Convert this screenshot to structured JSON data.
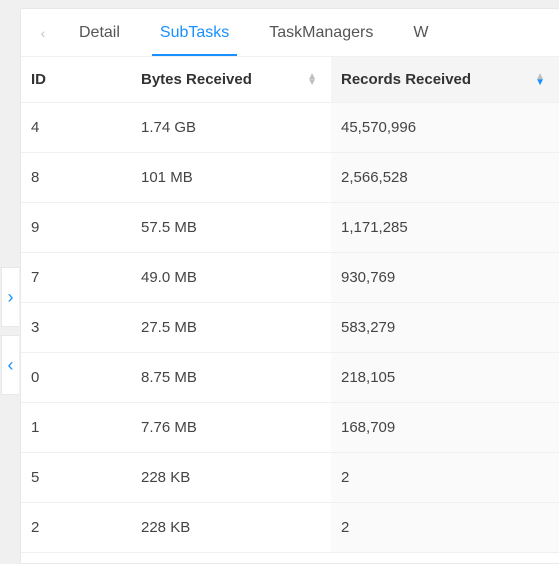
{
  "tabs": {
    "items": [
      {
        "label": "Detail"
      },
      {
        "label": "SubTasks"
      },
      {
        "label": "TaskManagers"
      },
      {
        "label": "W"
      }
    ],
    "active_index": 1
  },
  "columns": {
    "id": "ID",
    "bytes_received": "Bytes Received",
    "records_received": "Records Received"
  },
  "sort": {
    "column": "records_received",
    "direction": "desc"
  },
  "rows": [
    {
      "id": "4",
      "bytes_received": "1.74 GB",
      "records_received": "45,570,996"
    },
    {
      "id": "8",
      "bytes_received": "101 MB",
      "records_received": "2,566,528"
    },
    {
      "id": "9",
      "bytes_received": "57.5 MB",
      "records_received": "1,171,285"
    },
    {
      "id": "7",
      "bytes_received": "49.0 MB",
      "records_received": "930,769"
    },
    {
      "id": "3",
      "bytes_received": "27.5 MB",
      "records_received": "583,279"
    },
    {
      "id": "0",
      "bytes_received": "8.75 MB",
      "records_received": "218,105"
    },
    {
      "id": "1",
      "bytes_received": "7.76 MB",
      "records_received": "168,709"
    },
    {
      "id": "5",
      "bytes_received": "228 KB",
      "records_received": "2"
    },
    {
      "id": "2",
      "bytes_received": "228 KB",
      "records_received": "2"
    }
  ],
  "chart_data": {
    "type": "table",
    "title": "SubTasks",
    "columns": [
      "ID",
      "Bytes Received",
      "Records Received"
    ],
    "sort": {
      "column": "Records Received",
      "direction": "desc"
    },
    "rows": [
      [
        "4",
        "1.74 GB",
        "45,570,996"
      ],
      [
        "8",
        "101 MB",
        "2,566,528"
      ],
      [
        "9",
        "57.5 MB",
        "1,171,285"
      ],
      [
        "7",
        "49.0 MB",
        "930,769"
      ],
      [
        "3",
        "27.5 MB",
        "583,279"
      ],
      [
        "0",
        "8.75 MB",
        "218,105"
      ],
      [
        "1",
        "7.76 MB",
        "168,709"
      ],
      [
        "5",
        "228 KB",
        "2"
      ],
      [
        "2",
        "228 KB",
        "2"
      ]
    ]
  }
}
